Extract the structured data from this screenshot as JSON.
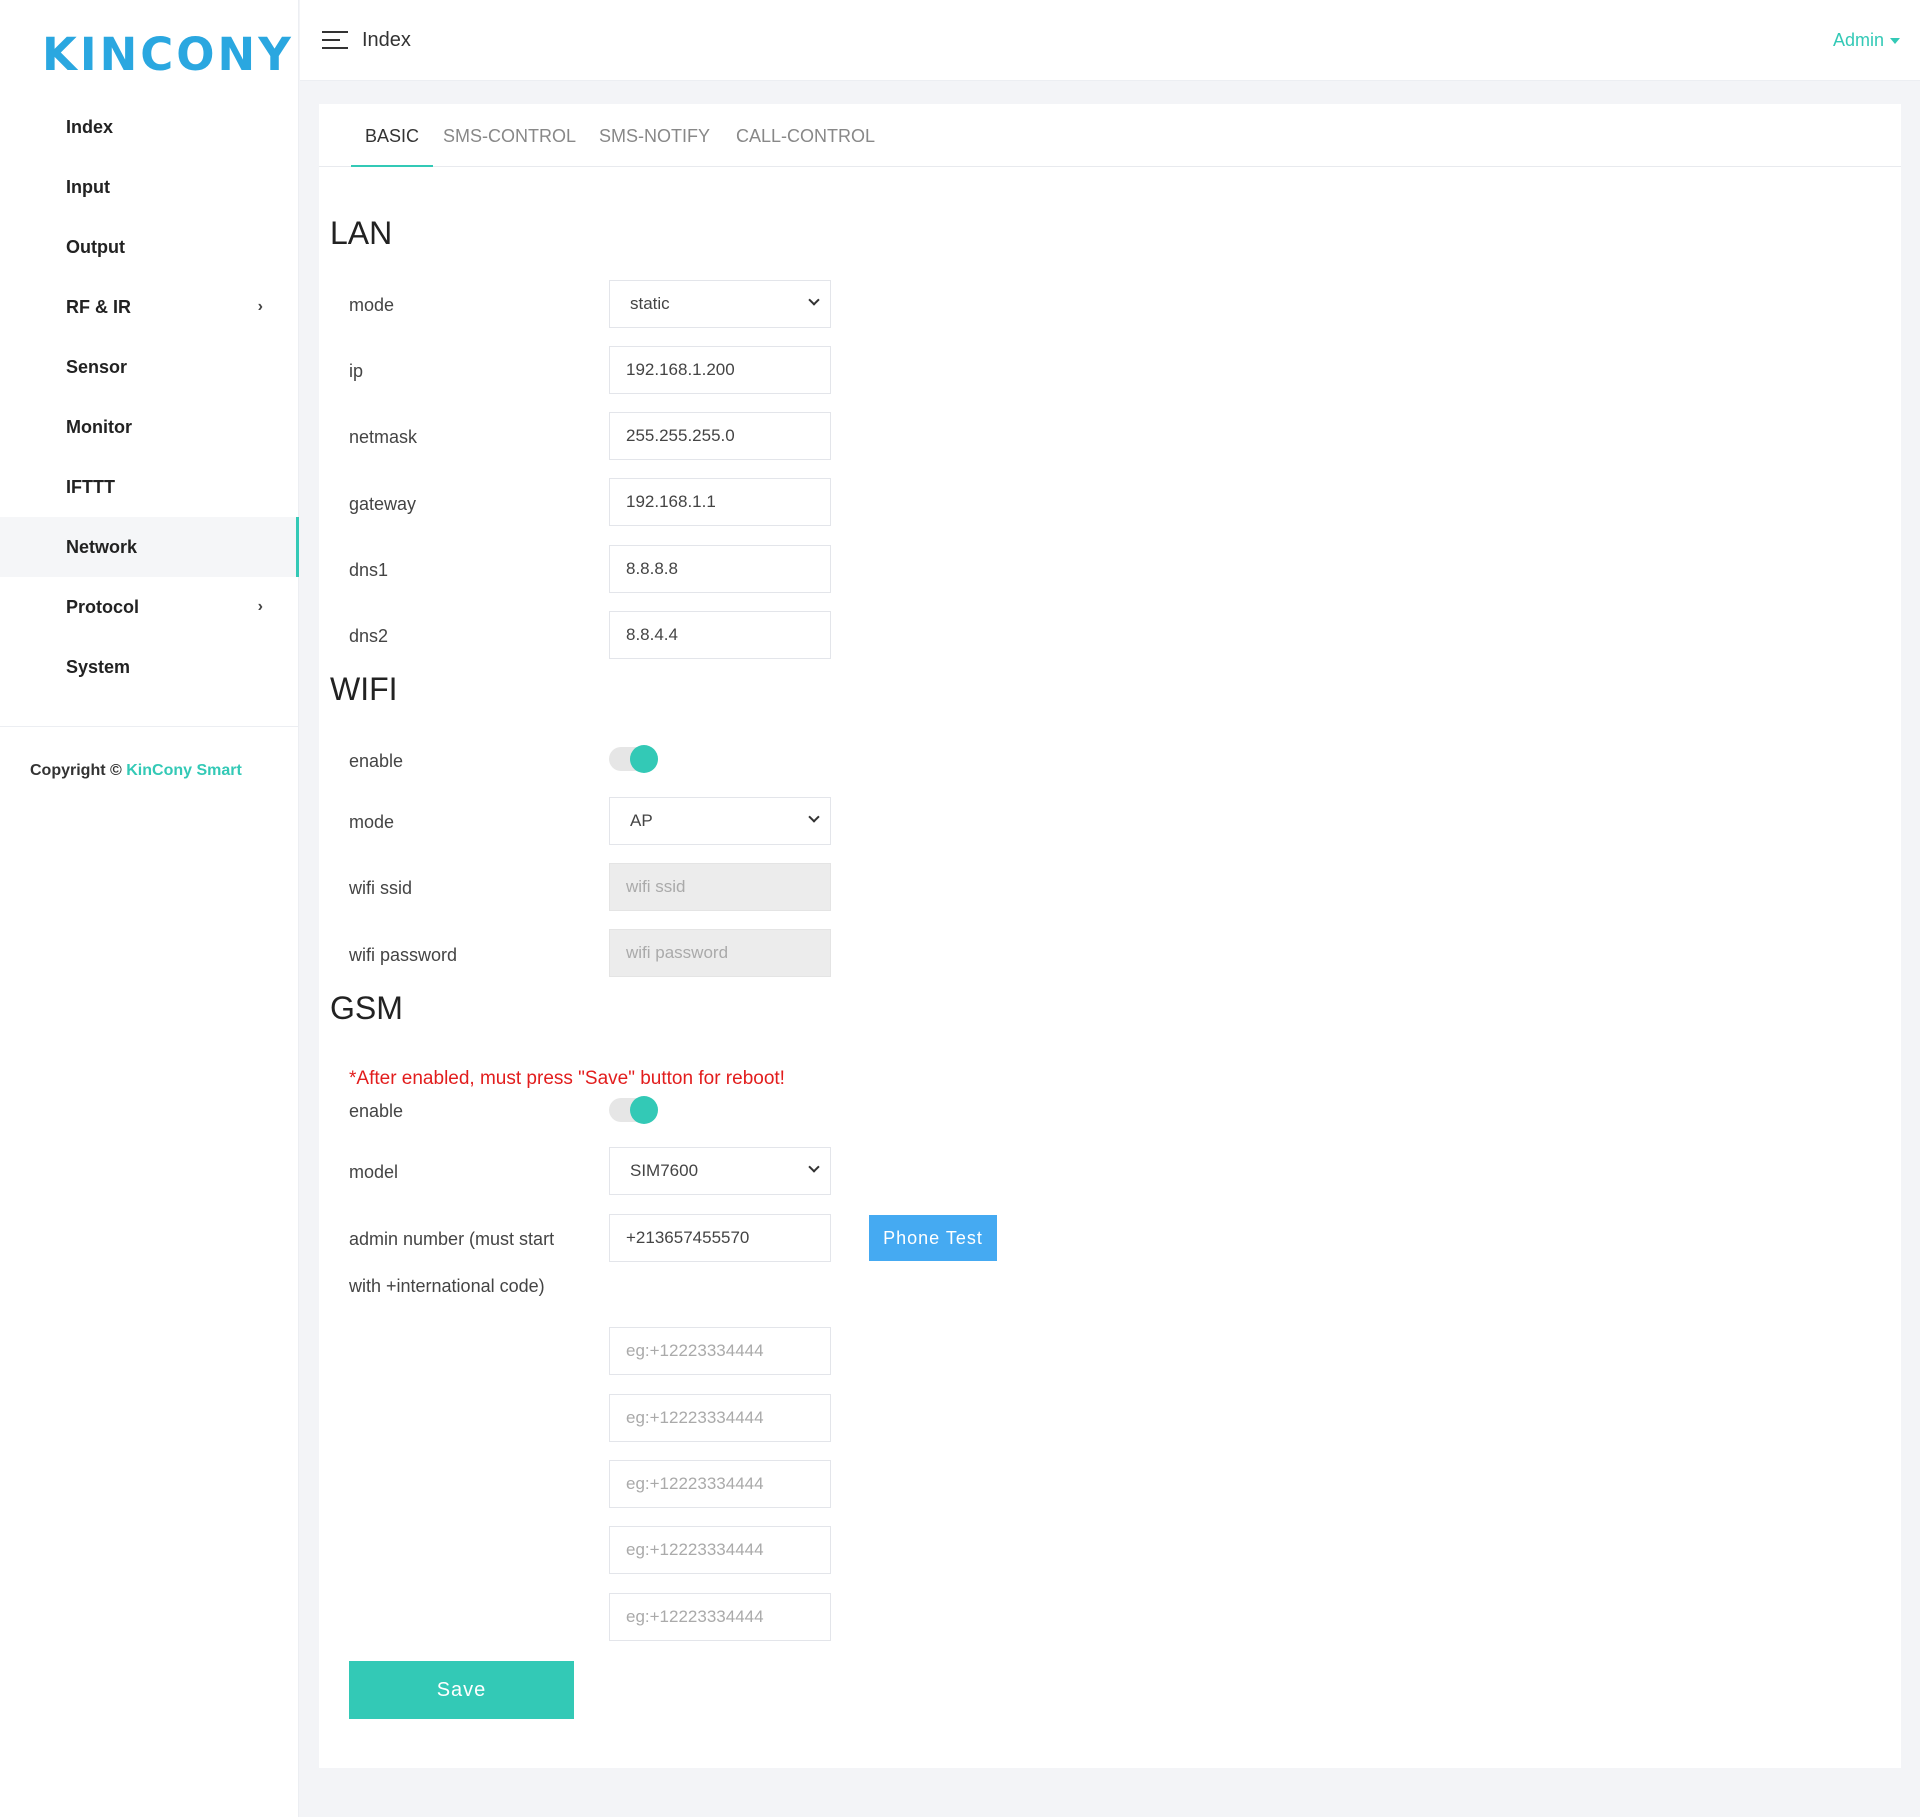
{
  "brand": {
    "logo_text": "KINCONY"
  },
  "sidebar": {
    "items": [
      {
        "label": "Index"
      },
      {
        "label": "Input"
      },
      {
        "label": "Output"
      },
      {
        "label": "RF & IR",
        "chevron": "chevron-right-icon"
      },
      {
        "label": "Sensor"
      },
      {
        "label": "Monitor"
      },
      {
        "label": "IFTTT"
      },
      {
        "label": "Network",
        "active": true
      },
      {
        "label": "Protocol",
        "chevron": "chevron-right-icon"
      },
      {
        "label": "System"
      }
    ],
    "chevron_glyph": "›",
    "copyright_prefix": "Copyright ©",
    "copyright_link": "KinCony Smart"
  },
  "header": {
    "title": "Index",
    "user": "Admin"
  },
  "tabs": [
    {
      "label": "BASIC",
      "active": true
    },
    {
      "label": "SMS-CONTROL"
    },
    {
      "label": "SMS-NOTIFY"
    },
    {
      "label": "CALL-CONTROL"
    }
  ],
  "lan": {
    "title": "LAN",
    "mode_label": "mode",
    "mode_value": "static",
    "ip_label": "ip",
    "ip_value": "192.168.1.200",
    "netmask_label": "netmask",
    "netmask_value": "255.255.255.0",
    "gateway_label": "gateway",
    "gateway_value": "192.168.1.1",
    "dns1_label": "dns1",
    "dns1_value": "8.8.8.8",
    "dns2_label": "dns2",
    "dns2_value": "8.8.4.4"
  },
  "wifi": {
    "title": "WIFI",
    "enable_label": "enable",
    "enabled": true,
    "mode_label": "mode",
    "mode_value": "AP",
    "ssid_label": "wifi ssid",
    "ssid_placeholder": "wifi ssid",
    "password_label": "wifi password",
    "password_placeholder": "wifi password"
  },
  "gsm": {
    "title": "GSM",
    "warning": "*After enabled, must press \"Save\" button for reboot!",
    "enable_label": "enable",
    "enabled": true,
    "model_label": "model",
    "model_value": "SIM7600",
    "admin_label_line1": "admin number (must start",
    "admin_label_line2": "with +international code)",
    "admin_value": "+213657455570",
    "phone_test_label": "Phone Test",
    "extra_placeholder": "eg:+12223334444"
  },
  "actions": {
    "save_label": "Save"
  },
  "colors": {
    "accent": "#33c9b6",
    "logo": "#2aa7e0",
    "phone_button": "#45aaf2",
    "warning": "#e21d1d"
  }
}
